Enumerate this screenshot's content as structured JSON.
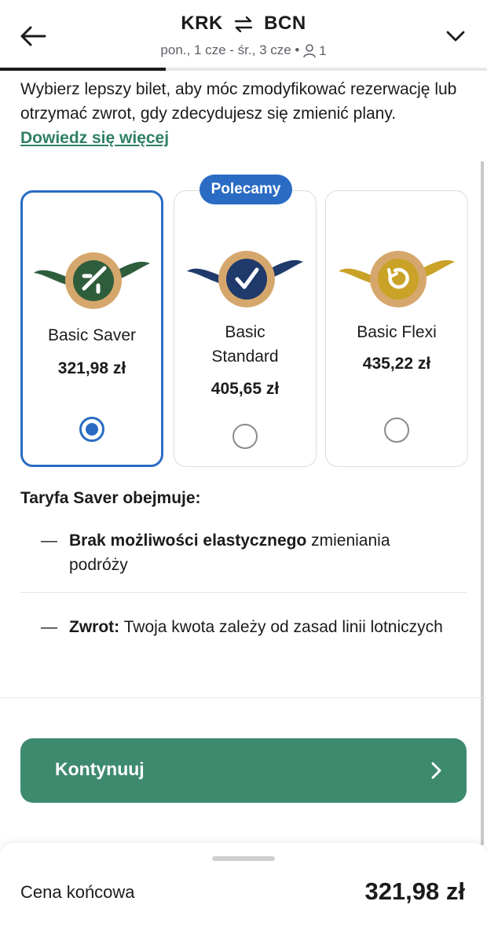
{
  "header": {
    "origin": "KRK",
    "destination": "BCN",
    "dates": "pon., 1 cze - śr., 3 cze •",
    "passengers": "1",
    "progress": 0.34
  },
  "intro": {
    "text": "Wybierz lepszy bilet, aby móc zmodyfikować rezerwację lub otrzymać zwrot, gdy zdecydujesz się zmienić plany. ",
    "link": "Dowiedz się więcej"
  },
  "fares": {
    "recommended_badge": "Polecamy",
    "items": [
      {
        "title": "Basic Saver",
        "price": "321,98 zł",
        "selected": true,
        "badge_color": "#2e5d3c",
        "icon": "plane-icon"
      },
      {
        "title": "Basic Standard",
        "price": "405,65 zł",
        "selected": false,
        "badge_color": "#1f3a6b",
        "icon": "check-icon"
      },
      {
        "title": "Basic Flexi",
        "price": "435,22 zł",
        "selected": false,
        "badge_color": "#c9a227",
        "icon": "refresh-icon"
      }
    ]
  },
  "includes": {
    "title": "Taryfa Saver obejmuje:",
    "items": [
      {
        "bold": "Brak możliwości elastycznego",
        "rest": " zmieniania podróży"
      },
      {
        "bold": "Zwrot:",
        "rest": " Twoja kwota zależy od zasad linii lotniczych"
      }
    ]
  },
  "continue_label": "Kontynuuj",
  "footer": {
    "total_label": "Cena końcowa",
    "total_value": "321,98 zł"
  },
  "colors": {
    "accent_blue": "#2a6cc4",
    "primary_green": "#3e8a6e",
    "link_green": "#2f7f66"
  }
}
